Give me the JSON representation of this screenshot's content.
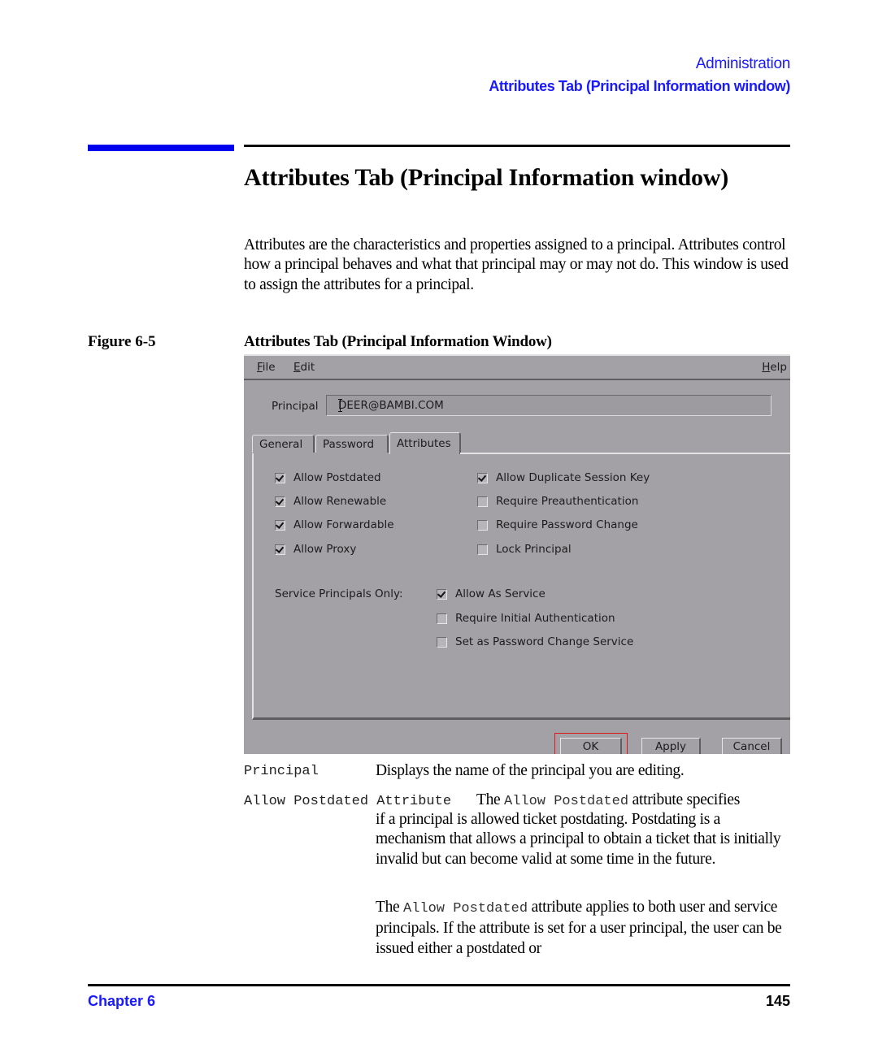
{
  "header": {
    "section": "Administration",
    "topic": "Attributes Tab (Principal Information window)"
  },
  "page_title": "Attributes Tab (Principal Information window)",
  "intro": "Attributes are the characteristics and properties assigned to a principal. Attributes control how a principal behaves and what that principal may or may not do. This window is used to assign the attributes for a principal.",
  "figure": {
    "label": "Figure 6-5",
    "title": "Attributes Tab (Principal Information Window)"
  },
  "window": {
    "menu": {
      "file": "File",
      "edit": "Edit",
      "help": "Help"
    },
    "principal_label": "Principal",
    "principal_value": "DEER@BAMBI.COM",
    "tabs": [
      {
        "label": "General",
        "active": false
      },
      {
        "label": "Password",
        "active": false
      },
      {
        "label": "Attributes",
        "active": true
      }
    ],
    "left_checkboxes": [
      {
        "label": "Allow Postdated",
        "checked": true
      },
      {
        "label": "Allow Renewable",
        "checked": true
      },
      {
        "label": "Allow Forwardable",
        "checked": true
      },
      {
        "label": "Allow Proxy",
        "checked": true
      }
    ],
    "right_checkboxes": [
      {
        "label": "Allow Duplicate Session Key",
        "checked": true
      },
      {
        "label": "Require Preauthentication",
        "checked": false
      },
      {
        "label": "Require Password Change",
        "checked": false
      },
      {
        "label": "Lock Principal",
        "checked": false
      }
    ],
    "service_label": "Service Principals Only:",
    "service_checkboxes": [
      {
        "label": "Allow As Service",
        "checked": true
      },
      {
        "label": "Require Initial Authentication",
        "checked": false
      },
      {
        "label": "Set as Password Change Service",
        "checked": false
      }
    ],
    "buttons": {
      "ok": "OK",
      "apply": "Apply",
      "cancel": "Cancel"
    },
    "focus_color": "#e01818"
  },
  "definitions": {
    "principal_term": "Principal",
    "principal_def": "Displays the name of the principal you are editing.",
    "postdated_term": "Allow Postdated Attribute",
    "postdated_p1_a": "The ",
    "postdated_p1_code": "Allow Postdated",
    "postdated_p1_b": " attribute specifies",
    "postdated_p1_rest": "if a principal is allowed ticket postdating. Postdating is a mechanism that allows a principal to obtain a ticket that is initially invalid but can become valid at some time in the future.",
    "postdated_p2_a": "The ",
    "postdated_p2_code": "Allow Postdated",
    "postdated_p2_b": " attribute applies to both user and service principals. If the attribute is set for a user principal, the user can be issued either a postdated or"
  },
  "footer": {
    "chapter": "Chapter 6",
    "page": "145"
  },
  "colors": {
    "accent_blue": "#1a1aff",
    "bar_blue": "#0000ee",
    "window_gray": "#a3a1a6"
  }
}
